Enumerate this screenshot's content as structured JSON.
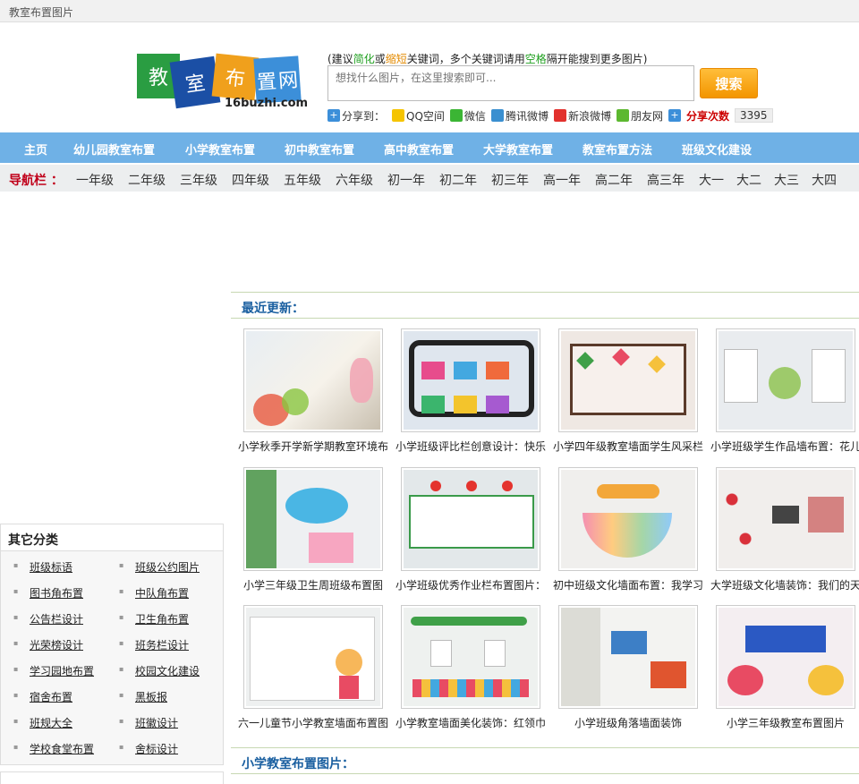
{
  "topbar": {
    "title": "教室布置图片"
  },
  "logo": {
    "chars": [
      "教",
      "室",
      "布",
      "置",
      "网"
    ],
    "domain": "16buzhi.com"
  },
  "search": {
    "hint_parts": [
      "(建议",
      "简化",
      "或",
      "缩短",
      "关键词，多个关键词请用",
      "空格",
      "隔开能搜到更多图片)"
    ],
    "placeholder": "想找什么图片，在这里搜索即可...",
    "button": "搜索"
  },
  "share": {
    "label": "分享到：",
    "items": [
      "QQ空间",
      "微信",
      "腾讯微博",
      "新浪微博",
      "朋友网"
    ],
    "count_label": "分享次数",
    "count": "3395"
  },
  "mainnav": [
    "主页",
    "幼儿园教室布置",
    "小学教室布置",
    "初中教室布置",
    "高中教室布置",
    "大学教室布置",
    "教室布置方法",
    "班级文化建设"
  ],
  "subnav": {
    "title": "导航栏 ：",
    "items": [
      "一年级",
      "二年级",
      "三年级",
      "四年级",
      "五年级",
      "六年级",
      "初一年",
      "初二年",
      "初三年",
      "高一年",
      "高二年",
      "高三年",
      "大一",
      "大二",
      "大三",
      "大四"
    ]
  },
  "sidebar": {
    "title": "其它分类",
    "items": [
      "班级标语",
      "班级公约图片",
      "图书角布置",
      "中队角布置",
      "公告栏设计",
      "卫生角布置",
      "光荣榜设计",
      "班务栏设计",
      "学习园地布置",
      "校园文化建设",
      "宿舍布置",
      "黑板报",
      "班规大全",
      "班徽设计",
      "学校食堂布置",
      "舍标设计"
    ]
  },
  "latest": {
    "title": "最近更新：",
    "items": [
      "小学秋季开学新学期教室环境布置",
      "小学班级评比栏创意设计：快乐列车",
      "小学四年级教室墙面学生风采栏",
      "小学班级学生作品墙布置：花儿朵朵",
      "小学三年级卫生周班级布置图",
      "小学班级优秀作业栏布置图片：",
      "初中班级文化墙面布置：我学习我快乐",
      "大学班级文化墙装饰：我们的天空",
      "六一儿童节小学教室墙面布置图",
      "小学教室墙面美化装饰：红领巾",
      "小学班级角落墙面装饰",
      "小学三年级教室布置图片"
    ]
  },
  "section2": {
    "title": "小学教室布置图片："
  },
  "colors": {
    "nav": "#6fb1e6",
    "accent": "#f39500",
    "red": "#c0001a",
    "link": "#1a5fa0"
  }
}
